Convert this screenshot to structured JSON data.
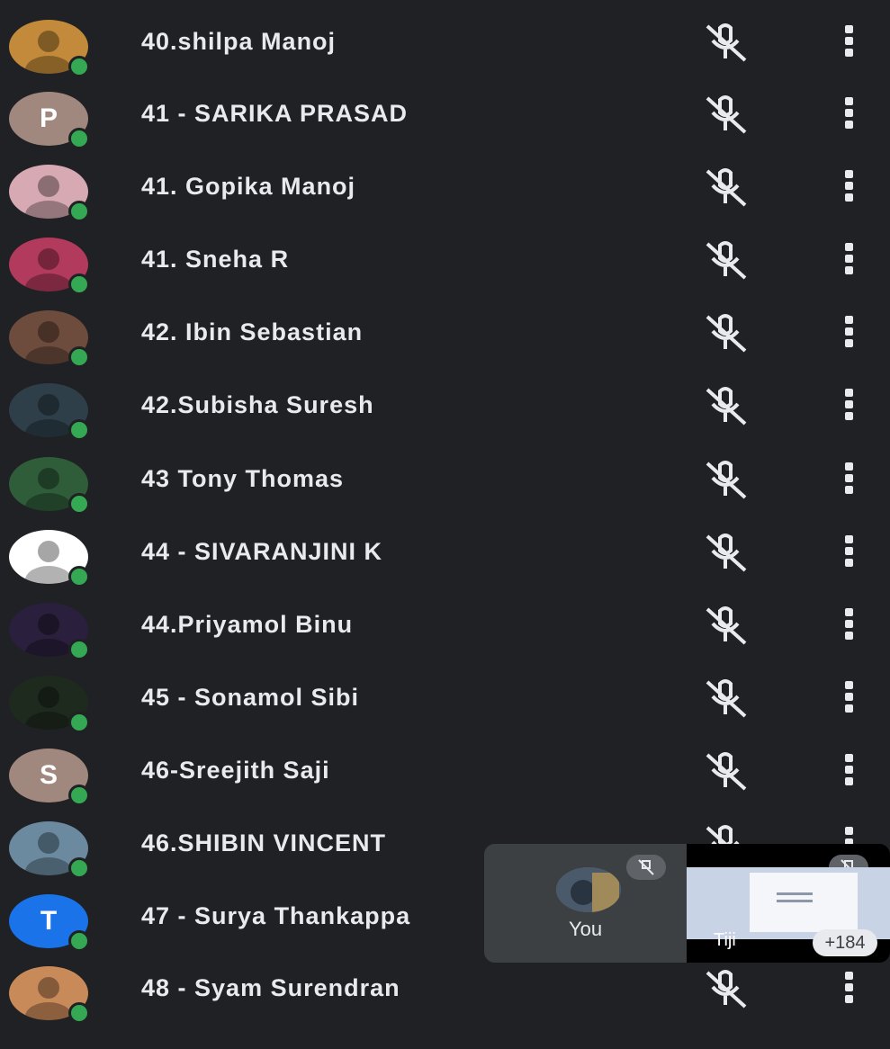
{
  "participants": [
    {
      "name": "40.shilpa Manoj",
      "avatar_type": "photo",
      "avatar_color": "#c28a3a"
    },
    {
      "name": "41 - SARIKA PRASAD",
      "avatar_type": "letter",
      "initial": "P",
      "avatar_color": "#a1887f"
    },
    {
      "name": "41. Gopika Manoj",
      "avatar_type": "photo",
      "avatar_color": "#d6a9b3"
    },
    {
      "name": "41. Sneha R",
      "avatar_type": "photo",
      "avatar_color": "#b23a5c"
    },
    {
      "name": "42. Ibin Sebastian",
      "avatar_type": "photo",
      "avatar_color": "#6d4c3d"
    },
    {
      "name": "42.Subisha Suresh",
      "avatar_type": "photo",
      "avatar_color": "#2f3f4a"
    },
    {
      "name": "43 Tony Thomas",
      "avatar_type": "photo",
      "avatar_color": "#2f5d3a"
    },
    {
      "name": "44 - SIVARANJINI K",
      "avatar_type": "photo",
      "avatar_color": "#ffffff"
    },
    {
      "name": "44.Priyamol Binu",
      "avatar_type": "photo",
      "avatar_color": "#2a1f3d"
    },
    {
      "name": "45 - Sonamol Sibi",
      "avatar_type": "photo",
      "avatar_color": "#1f2a1f"
    },
    {
      "name": "46-Sreejith Saji",
      "avatar_type": "letter",
      "initial": "S",
      "avatar_color": "#a1887f"
    },
    {
      "name": "46.SHIBIN VINCENT",
      "avatar_type": "photo",
      "avatar_color": "#6b8aa0"
    },
    {
      "name": "47 - Surya Thankappa",
      "avatar_type": "letter",
      "initial": "T",
      "avatar_color": "#1a73e8"
    },
    {
      "name": "48 - Syam Surendran",
      "avatar_type": "photo",
      "avatar_color": "#c98a5a"
    }
  ],
  "icons": {
    "mute": "mic-off-icon",
    "more": "more-vert-icon"
  },
  "self_tile": {
    "label": "You"
  },
  "screen_tile": {
    "label": "Tiji",
    "more_count": "+184"
  },
  "colors": {
    "background": "#202124",
    "online": "#34a853",
    "text": "#e8eaed"
  }
}
